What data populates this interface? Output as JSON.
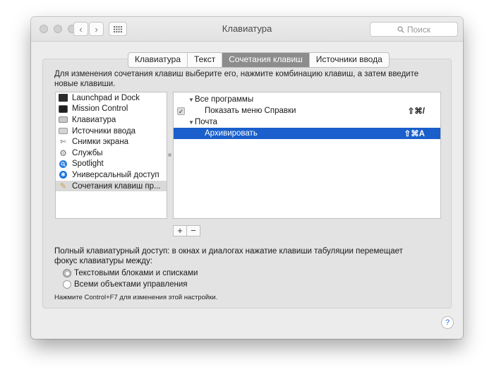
{
  "window": {
    "title": "Клавиатура",
    "search_placeholder": "Поиск",
    "back_glyph": "‹",
    "forward_glyph": "›",
    "grid_icon": "grid-icon",
    "search_icon": "magnifier"
  },
  "tabs": [
    {
      "label": "Клавиатура",
      "active": false
    },
    {
      "label": "Текст",
      "active": false
    },
    {
      "label": "Сочетания клавиш",
      "active": true
    },
    {
      "label": "Источники ввода",
      "active": false
    }
  ],
  "description": "Для изменения сочетания клавиш выберите его, нажмите комбинацию клавиш, а затем введите новые клавиши.",
  "categories": [
    {
      "label": "Launchpad и Dock",
      "icon": "launchpad-dock-icon",
      "color": "#2b2b2b"
    },
    {
      "label": "Mission Control",
      "icon": "mission-control-icon",
      "color": "#1f1f1f"
    },
    {
      "label": "Клавиатура",
      "icon": "keyboard-icon",
      "color": "#9e9e9e"
    },
    {
      "label": "Источники ввода",
      "icon": "input-sources-icon",
      "color": "#b5b5b5"
    },
    {
      "label": "Снимки экрана",
      "icon": "screenshot-icon",
      "color": "#8a8a8a"
    },
    {
      "label": "Службы",
      "icon": "services-icon",
      "color": "#7a7a7a"
    },
    {
      "label": "Spotlight",
      "icon": "spotlight-icon",
      "color": "#2d7fe0"
    },
    {
      "label": "Универсальный доступ",
      "icon": "accessibility-icon",
      "color": "#1d74e0"
    },
    {
      "label": "Сочетания клавиш пр...",
      "icon": "app-shortcuts-icon",
      "color": "#c9a13b",
      "selected": true
    }
  ],
  "shortcuts": {
    "group1": "Все программы",
    "item1": {
      "label": "Показать меню Справки",
      "shortcut": "⇧⌘/",
      "checked": true
    },
    "group2": "Почта",
    "item2": {
      "label": "Архивировать",
      "shortcut": "⇧⌘A",
      "selected": true
    }
  },
  "buttons": {
    "add": "+",
    "remove": "−"
  },
  "keyboard_access": {
    "text": "Полный клавиатурный доступ: в окнах и диалогах нажатие клавиши табуляции перемещает фокус клавиатуры между:",
    "options": [
      {
        "label": "Текстовыми блоками и списками",
        "selected": true
      },
      {
        "label": "Всеми объектами управления",
        "selected": false
      }
    ],
    "note": "Нажмите Control+F7 для изменения этой настройки."
  },
  "help": "?",
  "colors": {
    "selection": "#1a5fcb",
    "active_tab": "#8c8c8c"
  }
}
